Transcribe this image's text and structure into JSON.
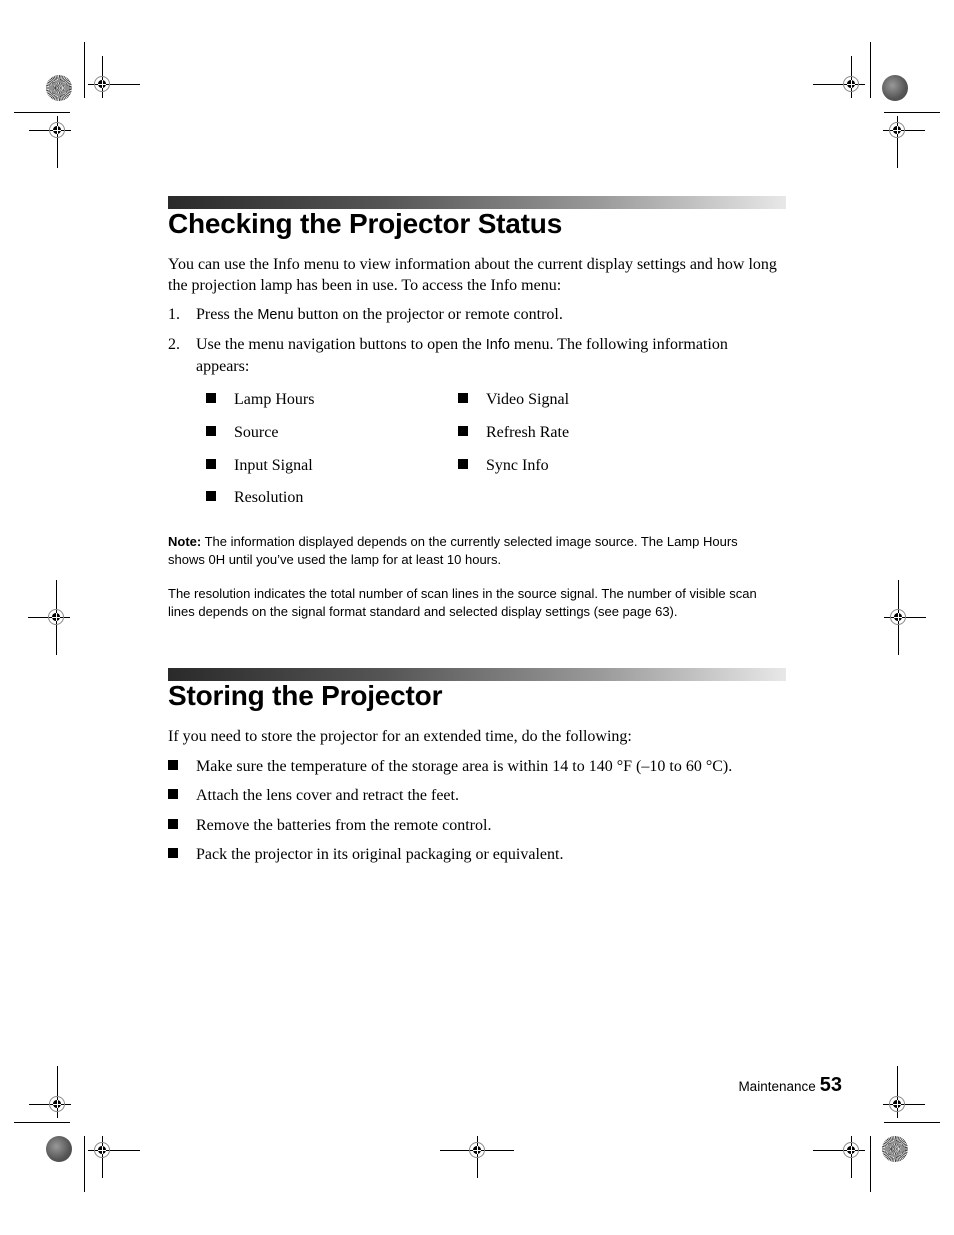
{
  "section1": {
    "title": "Checking the Projector Status",
    "intro": "You can use the Info menu to view information about the current display settings and how long the projection lamp has been in use. To access the Info menu:",
    "steps": [
      {
        "num": "1.",
        "pre": "Press the ",
        "ui": "Menu",
        "post": " button on the projector or remote control."
      },
      {
        "num": "2.",
        "pre": "Use the menu navigation buttons to open the ",
        "ui": "Info",
        "post": " menu. The following information appears:"
      }
    ],
    "info_items_left": [
      "Lamp Hours",
      "Source",
      "Input Signal",
      "Resolution"
    ],
    "info_items_right": [
      "Video Signal",
      "Refresh Rate",
      "Sync Info"
    ],
    "note_label": "Note:",
    "note_text": " The information displayed depends on the currently selected image source. The Lamp Hours shows 0H until you’ve used the lamp for at least 10 hours.",
    "note_text2": "The resolution indicates the total number of scan lines in the source signal. The number of visible scan lines depends on the signal format standard and selected display settings (see page 63)."
  },
  "section2": {
    "title": "Storing the Projector",
    "intro": "If you need to store the projector for an extended time, do the following:",
    "bullets": [
      "Make sure the temperature of the storage area is within 14 to 140 °F (–10 to 60 °C).",
      "Attach the lens cover and retract the feet.",
      "Remove the batteries from the remote control.",
      "Pack the projector in its original packaging or equivalent."
    ]
  },
  "footer": {
    "section": "Maintenance",
    "page_number": "53"
  }
}
